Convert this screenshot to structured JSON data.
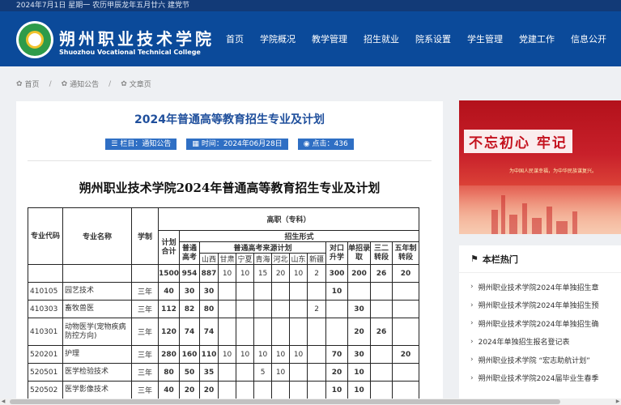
{
  "topbar": {
    "date_text": "2024年7月1日 星期一 农历甲辰龙年五月廿六 建党节"
  },
  "header": {
    "school_name_cn": "朔州职业技术学院",
    "school_name_en": "Shuozhou Vocational Technical College",
    "nav": [
      "首页",
      "学院概况",
      "教学管理",
      "招生就业",
      "院系设置",
      "学生管理",
      "党建工作",
      "信息公开"
    ]
  },
  "breadcrumb": [
    "首页",
    "通知公告",
    "文章页"
  ],
  "article": {
    "title": "2024年普通高等教育招生专业及计划",
    "meta": [
      {
        "icon": "list-icon",
        "text": "栏目：通知公告"
      },
      {
        "icon": "calendar-icon",
        "text": "时间：2024年06月28日"
      },
      {
        "icon": "eye-icon",
        "text": "点击：436"
      }
    ],
    "doc_title": "朔州职业技术学院2024年普通高等教育招生专业及计划"
  },
  "table": {
    "h_code": "专业代码",
    "h_name": "专业名称",
    "h_years": "学制",
    "h_level": "高职（专科）",
    "h_total": "计划合计",
    "h_form": "招生形式",
    "h_gaokao": "普通高考",
    "h_source": "普通高考来源计划",
    "h_provinces": [
      "山西",
      "甘肃",
      "宁夏",
      "青海",
      "河北",
      "山东",
      "新疆"
    ],
    "h_duikou": "对口升学",
    "h_danzhao": "单招录取",
    "h_sanzhuan": "三二转段",
    "h_wunian": "五年制转段",
    "totals": [
      "1500",
      "954",
      "887",
      "10",
      "10",
      "15",
      "20",
      "10",
      "2",
      "300",
      "200",
      "26",
      "20"
    ],
    "rows": [
      {
        "code": "410105",
        "name": "园艺技术",
        "years": "三年",
        "cells": [
          "40",
          "30",
          "30",
          "",
          "",
          "",
          "",
          "",
          "",
          "10",
          "",
          "",
          ""
        ]
      },
      {
        "code": "410303",
        "name": "畜牧兽医",
        "years": "三年",
        "cells": [
          "112",
          "82",
          "80",
          "",
          "",
          "",
          "",
          "",
          "2",
          "",
          "30",
          "",
          ""
        ]
      },
      {
        "code": "410301",
        "name": "动物医学(宠物疾病防控方向)",
        "years": "三年",
        "cells": [
          "120",
          "74",
          "74",
          "",
          "",
          "",
          "",
          "",
          "",
          "",
          "20",
          "26",
          ""
        ]
      },
      {
        "code": "520201",
        "name": "护理",
        "years": "三年",
        "cells": [
          "280",
          "160",
          "110",
          "10",
          "10",
          "10",
          "10",
          "10",
          "",
          "70",
          "30",
          "",
          "20"
        ]
      },
      {
        "code": "520501",
        "name": "医学检验技术",
        "years": "三年",
        "cells": [
          "80",
          "50",
          "35",
          "",
          "",
          "5",
          "10",
          "",
          "",
          "20",
          "10",
          "",
          ""
        ]
      },
      {
        "code": "520502",
        "name": "医学影像技术",
        "years": "三年",
        "cells": [
          "40",
          "20",
          "20",
          "",
          "",
          "",
          "",
          "",
          "",
          "10",
          "10",
          "",
          ""
        ]
      }
    ]
  },
  "banner": {
    "slogan": "不忘初心 牢记",
    "sub": "为中国人民谋幸福，为中华民族谋复兴。"
  },
  "hot": {
    "title": "本栏热门",
    "items": [
      "朔州职业技术学院2024年单独招生章",
      "朔州职业技术学院2024年单独招生预",
      "朔州职业技术学院2024年单独招生确",
      "2024年单独招生报名登记表",
      "朔州职业技术学院 “宏志助航计划”",
      "朔州职业技术学院2024届毕业生春季"
    ]
  }
}
